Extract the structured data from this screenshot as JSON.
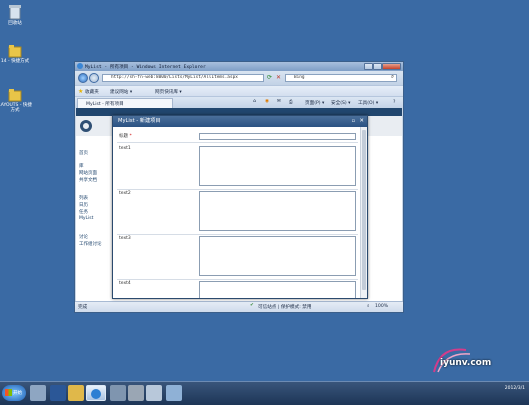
{
  "desktop": {
    "icons": [
      {
        "label": "回收站"
      },
      {
        "label": "14 - 快捷方式"
      },
      {
        "label": "LAYOUTS - 快捷方式"
      }
    ]
  },
  "browser": {
    "title": "MyList - 所有项目 - Windows Internet Explorer",
    "address": "http://sh-fn-web:8000/Lists/MyList/AllItems.aspx",
    "search_placeholder": "Bing",
    "favorites_label": "收藏夹",
    "fav_links": [
      "建议网站 ▾",
      "网页快讯库 ▾"
    ],
    "tab_label": "MyList - 所有项目",
    "cmd_page": "页面(P) ▾",
    "cmd_safety": "安全(S) ▾",
    "cmd_tools": "工具(O) ▾",
    "cmd_help": "?",
    "status_done": "完成",
    "status_zone": "可信站点 | 保护模式: 禁用",
    "zoom": "100%"
  },
  "sharepoint": {
    "nav_items": [
      "首页",
      "库",
      "网站页面",
      "共享文档",
      "列表",
      "日历",
      "任务",
      "MyList",
      "讨论",
      "工作组讨论"
    ]
  },
  "modal": {
    "title": "MyList - 新建项目",
    "fields": [
      {
        "label": "标题",
        "required_mark": "*"
      },
      {
        "label": "text1"
      },
      {
        "label": "text2"
      },
      {
        "label": "text3"
      },
      {
        "label": "text4"
      }
    ]
  },
  "taskbar": {
    "start_label": "开始",
    "clock": [
      "",
      "2012/3/1"
    ]
  },
  "watermark": "iyunv.com"
}
